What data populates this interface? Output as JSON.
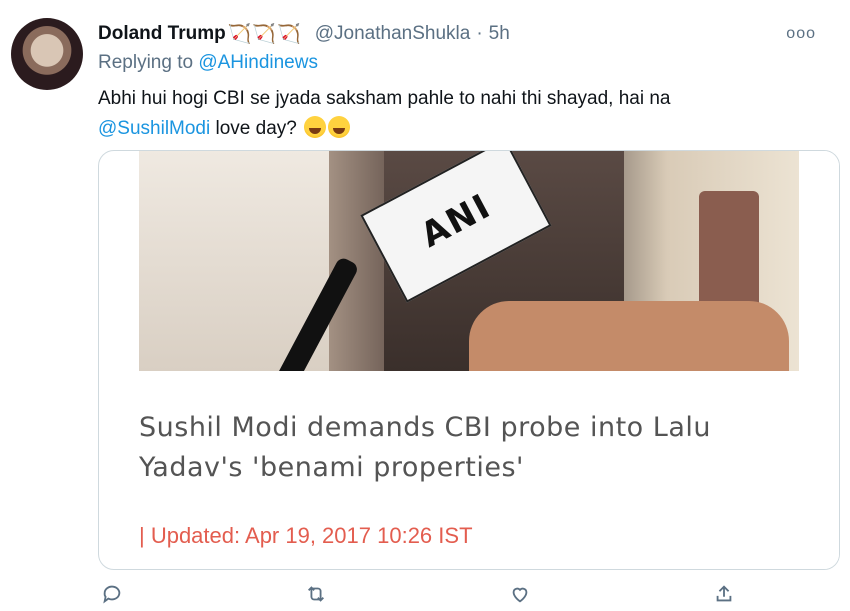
{
  "tweet": {
    "author_name": "Doland Trump",
    "handle": "@JonathanShukla",
    "separator": "·",
    "time": "5h",
    "more_label": "ooo",
    "replying_prefix": "Replying to",
    "replying_handle": "@AHindinews",
    "text_part1": "Abhi hui hogi CBI se jyada saksham pahle to nahi thi shayad, hai na",
    "text_mention": "@SushilModi",
    "text_part2": "love day?",
    "emoji_count": 2
  },
  "card": {
    "mic_label": "ANI",
    "title": "Sushil Modi demands CBI probe into Lalu Yadav's 'benami properties'",
    "updated": "| Updated: Apr 19, 2017 10:26 IST"
  },
  "actions": [
    {
      "name": "reply",
      "icon": "speech-bubble-icon"
    },
    {
      "name": "retweet",
      "icon": "retweet-icon"
    },
    {
      "name": "like",
      "icon": "heart-icon"
    },
    {
      "name": "share",
      "icon": "share-icon"
    }
  ],
  "colors": {
    "link": "#1b95e0",
    "secondary": "#5b7083",
    "updated": "#e35d4f",
    "bow": "#e0402a"
  }
}
